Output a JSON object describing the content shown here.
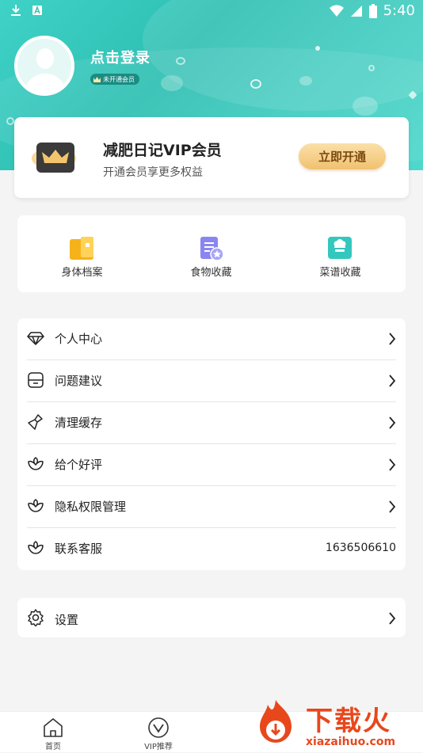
{
  "status_bar": {
    "time": "5:40"
  },
  "profile": {
    "login_text": "点击登录",
    "member_status": "未开通会员"
  },
  "vip_card": {
    "title": "减肥日记VIP会员",
    "subtitle": "开通会员享更多权益",
    "button_label": "立即开通"
  },
  "quick_links": [
    {
      "label": "身体档案",
      "icon": "body-file-icon"
    },
    {
      "label": "食物收藏",
      "icon": "food-favorite-icon"
    },
    {
      "label": "菜谱收藏",
      "icon": "recipe-favorite-icon"
    }
  ],
  "menu": [
    {
      "label": "个人中心",
      "icon": "diamond-icon"
    },
    {
      "label": "问题建议",
      "icon": "feedback-icon"
    },
    {
      "label": "清理缓存",
      "icon": "brush-icon"
    },
    {
      "label": "给个好评",
      "icon": "flower-icon"
    },
    {
      "label": "隐私权限管理",
      "icon": "flower-icon"
    },
    {
      "label": "联系客服",
      "icon": "flower-icon",
      "value": "1636506610"
    }
  ],
  "settings": {
    "label": "设置",
    "icon": "gear-icon"
  },
  "tabbar": [
    {
      "label": "首页",
      "icon": "home-icon"
    },
    {
      "label": "VIP推荐",
      "icon": "vip-icon"
    }
  ],
  "watermark": {
    "text": "下载火",
    "url": "xiazaihuo.com"
  },
  "colors": {
    "header": "#3fd2c6",
    "vip_button": "#f1c170",
    "watermark": "#e8471c"
  }
}
